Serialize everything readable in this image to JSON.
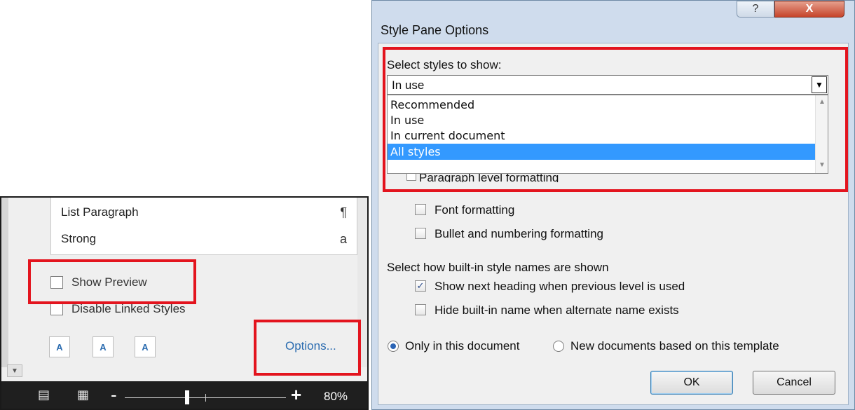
{
  "left_pane": {
    "style_list": [
      {
        "name": "List Paragraph",
        "marker": "¶"
      },
      {
        "name": "Strong",
        "marker": "a"
      }
    ],
    "show_preview": {
      "label": "Show Preview",
      "checked": false
    },
    "disable_linked_styles": {
      "label": "Disable Linked Styles",
      "checked": false
    },
    "tool_buttons": [
      {
        "name": "new-style-icon",
        "glyph": "A"
      },
      {
        "name": "style-inspector-icon",
        "glyph": "A"
      },
      {
        "name": "manage-styles-icon",
        "glyph": "A"
      }
    ],
    "options_link": "Options...",
    "status_bar": {
      "zoom_minus": "-",
      "zoom_plus": "+",
      "zoom_value": "80%"
    }
  },
  "dialog": {
    "title": "Style Pane Options",
    "help_glyph": "?",
    "close_glyph": "X",
    "select_styles_label": "Select styles to show:",
    "select_value": "In use",
    "dropdown_options": [
      "Recommended",
      "In use",
      "In current document",
      "All styles"
    ],
    "dropdown_selected": "All styles",
    "partial_option_label": "Paragraph level formatting",
    "checkboxes": [
      {
        "label": "Font formatting",
        "checked": false
      },
      {
        "label": "Bullet and numbering formatting",
        "checked": false
      }
    ],
    "builtin_section_label": "Select how built-in style names are shown",
    "builtin_checkboxes": [
      {
        "label": "Show next heading when previous level is used",
        "checked": true
      },
      {
        "label": "Hide built-in name when alternate name exists",
        "checked": false
      }
    ],
    "radios": [
      {
        "label": "Only in this document",
        "checked": true
      },
      {
        "label": "New documents based on this template",
        "checked": false
      }
    ],
    "ok_label": "OK",
    "cancel_label": "Cancel",
    "check_glyph": "✓",
    "dropdown_arrow": "▼"
  },
  "colors": {
    "highlight_red": "#e3141e",
    "selection_blue": "#3399ff",
    "link_blue": "#2b6cb0",
    "status_bar_bg": "#1f1f1f"
  }
}
